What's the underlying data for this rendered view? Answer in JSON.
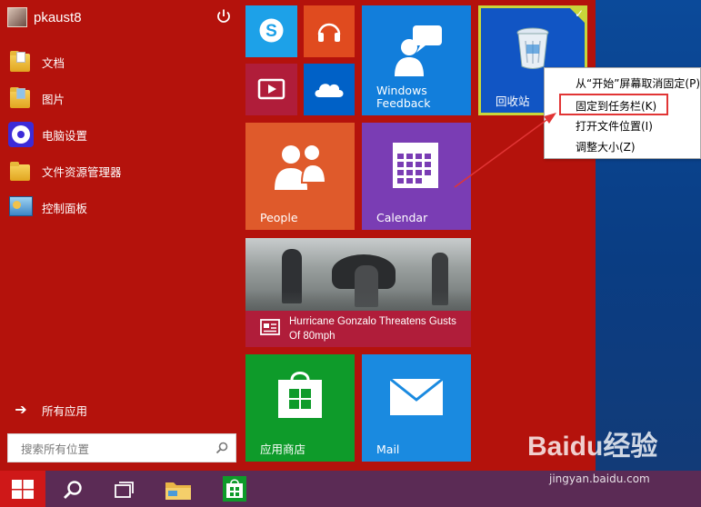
{
  "user": {
    "name": "pkaust8"
  },
  "left_menu": {
    "items": [
      {
        "label": "文档",
        "icon": "documents-folder-icon"
      },
      {
        "label": "图片",
        "icon": "pictures-folder-icon"
      },
      {
        "label": "电脑设置",
        "icon": "pc-settings-gear-icon"
      },
      {
        "label": "文件资源管理器",
        "icon": "file-explorer-folder-icon"
      },
      {
        "label": "控制面板",
        "icon": "control-panel-icon"
      }
    ],
    "all_apps": "所有应用",
    "search_placeholder": "搜索所有位置"
  },
  "tiles": {
    "skype": {
      "icon": "skype-icon",
      "color": "#1da1e8"
    },
    "music": {
      "icon": "headphones-icon",
      "color": "#e04b1f"
    },
    "video": {
      "icon": "video-icon",
      "color": "#b01d3a"
    },
    "onedrive": {
      "icon": "cloud-icon",
      "color": "#0061c7"
    },
    "feedback": {
      "label": "Windows\nFeedback",
      "color": "#127edb"
    },
    "recycle": {
      "label": "回收站",
      "color": "#1155c4"
    },
    "people": {
      "label": "People",
      "color": "#df5a2b"
    },
    "calendar": {
      "label": "Calendar",
      "color": "#7a3db4"
    },
    "news": {
      "headline": "Hurricane Gonzalo Threatens Gusts Of 80mph",
      "color": "#b01d3a"
    },
    "store": {
      "label": "应用商店",
      "color": "#0e9b2a"
    },
    "mail": {
      "label": "Mail",
      "color": "#1a8ae0"
    }
  },
  "context_menu": {
    "items": [
      {
        "label": "从“开始”屏幕取消固定(P)"
      },
      {
        "label": "固定到任务栏(K)",
        "highlighted": true
      },
      {
        "label": "打开文件位置(I)"
      },
      {
        "label": "调整大小(Z)"
      }
    ]
  },
  "taskbar": {
    "items": [
      "start-button",
      "search-button",
      "task-view-button",
      "file-explorer-button",
      "store-button"
    ],
    "color": "#5b2b55"
  },
  "watermark": {
    "brand": "Baidu经验",
    "url": "jingyan.baidu.com"
  },
  "colors": {
    "start_bg": "#b4120c",
    "highlight": "#e13535",
    "accent_check": "#c9d63a"
  }
}
